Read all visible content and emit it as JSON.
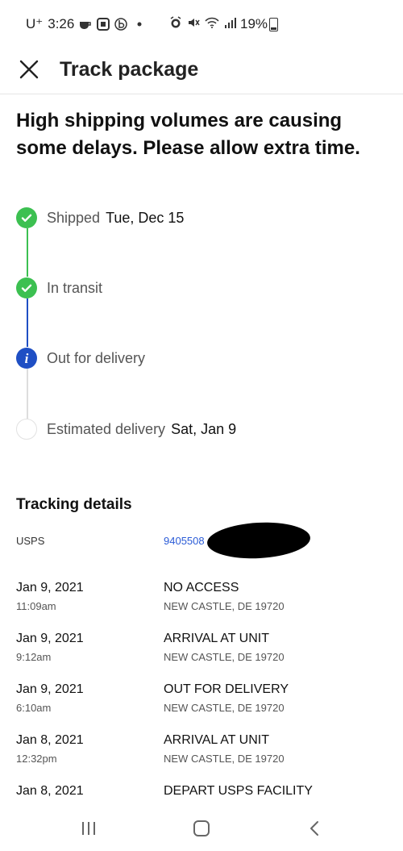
{
  "status_bar": {
    "carrier": "U⁺",
    "time": "3:26",
    "battery": "19%",
    "icons": [
      "coffee-icon",
      "square-app-icon",
      "b-app-icon",
      "dot-icon",
      "alarm-icon",
      "mute-icon",
      "wifi-icon",
      "signal-icon",
      "battery-icon"
    ]
  },
  "header": {
    "title": "Track package",
    "close_icon": "close-icon"
  },
  "banner": {
    "text": "High shipping volumes are causing some delays. Please allow extra time."
  },
  "timeline": {
    "steps": [
      {
        "label": "Shipped",
        "date": "Tue, Dec 15",
        "state": "done"
      },
      {
        "label": "In transit",
        "date": "",
        "state": "done"
      },
      {
        "label": "Out for delivery",
        "date": "",
        "state": "current"
      },
      {
        "label": "Estimated delivery",
        "date": "Sat, Jan 9",
        "state": "pending"
      }
    ]
  },
  "colors": {
    "done": "#3cc051",
    "current": "#1f4fc4",
    "link": "#2a5bd7",
    "pending_line": "#dddddd"
  },
  "tracking": {
    "title": "Tracking details",
    "carrier": "USPS",
    "number_visible": "9405508",
    "events": [
      {
        "date": "Jan 9, 2021",
        "time": "11:09am",
        "status": "NO ACCESS",
        "location": "NEW CASTLE, DE 19720"
      },
      {
        "date": "Jan 9, 2021",
        "time": "9:12am",
        "status": "ARRIVAL AT UNIT",
        "location": "NEW CASTLE, DE 19720"
      },
      {
        "date": "Jan 9, 2021",
        "time": "6:10am",
        "status": "OUT FOR DELIVERY",
        "location": "NEW CASTLE, DE 19720"
      },
      {
        "date": "Jan 8, 2021",
        "time": "12:32pm",
        "status": "ARRIVAL AT UNIT",
        "location": "NEW CASTLE, DE 19720"
      },
      {
        "date": "Jan 8, 2021",
        "time": "",
        "status": "DEPART USPS FACILITY",
        "location": ""
      }
    ]
  },
  "nav_bar": {
    "icons": [
      "recent-apps-icon",
      "home-icon",
      "back-icon"
    ]
  }
}
